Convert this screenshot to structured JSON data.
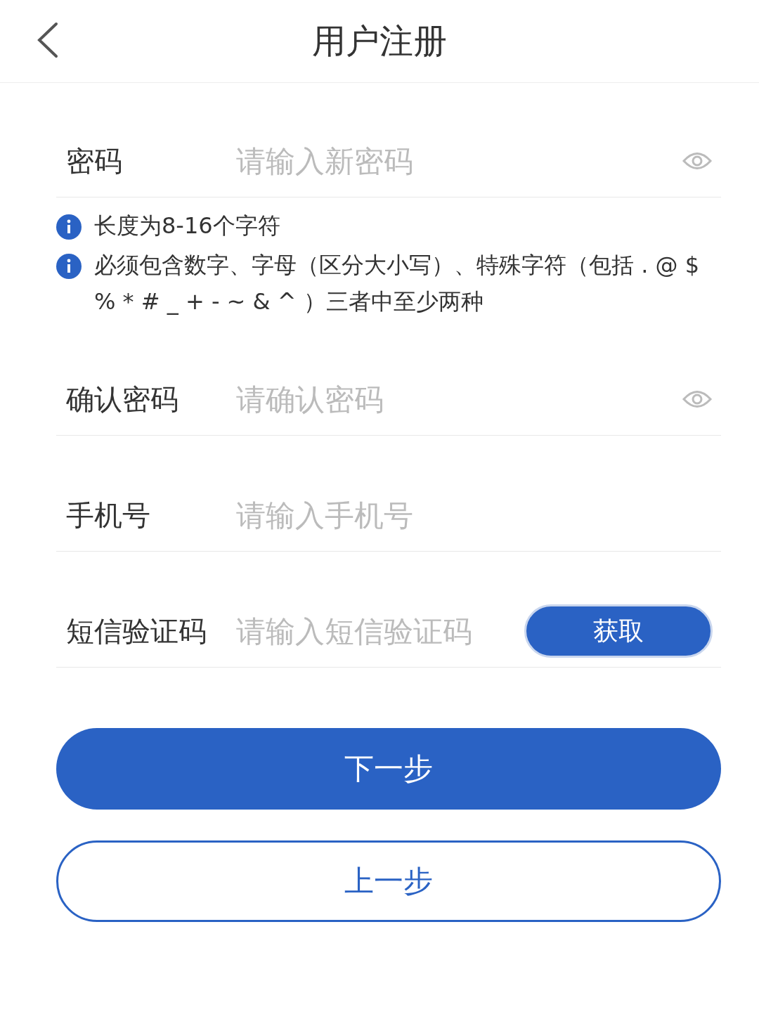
{
  "header": {
    "title": "用户注册"
  },
  "fields": [
    {
      "kind": "password",
      "label": "密码",
      "placeholder": "请输入新密码",
      "hints": [
        "长度为8-16个字符",
        "必须包含数字、字母（区分大小写）、特殊字符（包括 . @ $ % * # _ + - ~ & ^ ）三者中至少两种"
      ]
    },
    {
      "kind": "password",
      "label": "确认密码",
      "placeholder": "请确认密码"
    },
    {
      "kind": "text",
      "label": "手机号",
      "placeholder": "请输入手机号"
    },
    {
      "kind": "sms",
      "label": "短信验证码",
      "placeholder": "请输入短信验证码",
      "button": "获取"
    }
  ],
  "buttons": [
    {
      "kind": "primary",
      "label": "下一步"
    },
    {
      "kind": "outline",
      "label": "上一步"
    }
  ]
}
